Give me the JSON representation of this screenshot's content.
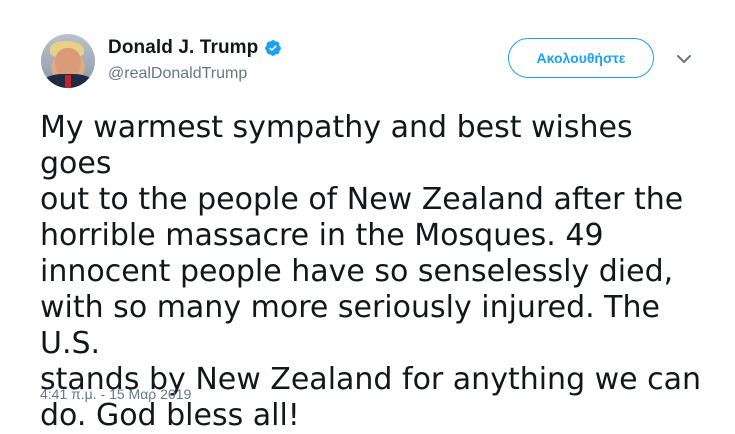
{
  "user": {
    "display_name": "Donald J. Trump",
    "handle": "@realDonaldTrump",
    "verified": true
  },
  "follow_button": {
    "label": "Ακολουθήστε"
  },
  "tweet": {
    "text": "My warmest sympathy and best wishes goes\nout to the people of New Zealand after the\nhorrible massacre in the Mosques. 49\ninnocent people have so senselessly died,\nwith so many more seriously injured. The U.S.\nstands by New Zealand for anything we can\ndo. God bless all!",
    "timestamp": "4:41 π.μ. - 15 Μαρ 2019"
  },
  "icons": {
    "verified": "verified-badge-icon",
    "caret": "chevron-down-icon"
  },
  "colors": {
    "accent": "#1da1f2",
    "text_primary": "#14171a",
    "text_secondary": "#657786"
  }
}
